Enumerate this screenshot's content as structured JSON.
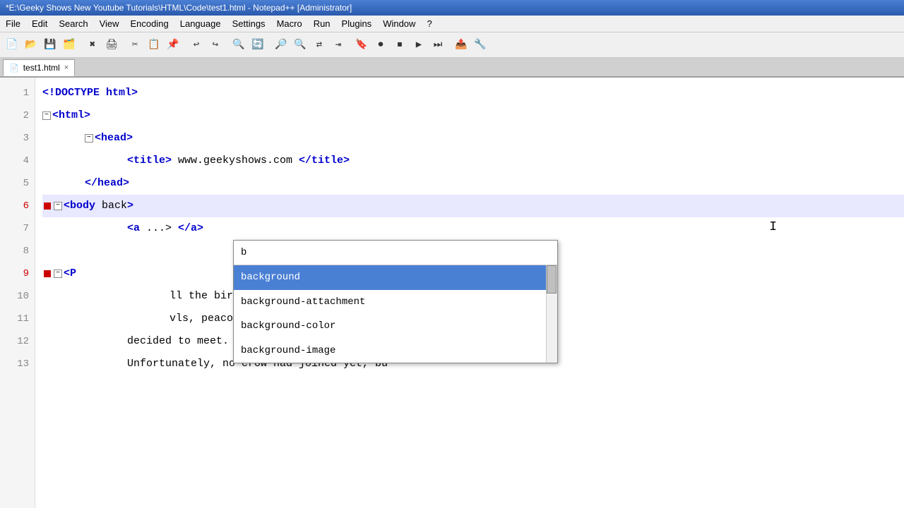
{
  "title_bar": {
    "text": "*E:\\Geeky Shows New Youtube Tutorials\\HTML\\Code\\test1.html - Notepad++ [Administrator]"
  },
  "menu": {
    "items": [
      "File",
      "Edit",
      "Search",
      "View",
      "Encoding",
      "Language",
      "Settings",
      "Macro",
      "Run",
      "Plugins",
      "Window",
      "?"
    ]
  },
  "tab": {
    "filename": "test1.html",
    "close_label": "×"
  },
  "code": {
    "lines": [
      {
        "num": 1,
        "content": "<!DOCTYPE html>",
        "type": "doctype",
        "indent": 0
      },
      {
        "num": 2,
        "content": "<html>",
        "type": "tag",
        "indent": 0,
        "collapse": true
      },
      {
        "num": 3,
        "content": "<head>",
        "type": "tag",
        "indent": 1,
        "collapse": true
      },
      {
        "num": 4,
        "content": "<title> www.geekyshows.com </title>",
        "type": "mixed",
        "indent": 2
      },
      {
        "num": 5,
        "content": "</head>",
        "type": "tag",
        "indent": 1
      },
      {
        "num": 6,
        "content": "<body back>",
        "type": "tag-partial",
        "indent": 1,
        "highlighted": true,
        "collapse": true
      },
      {
        "num": 7,
        "content": "<a ...> </a>",
        "type": "tag",
        "indent": 2
      },
      {
        "num": 8,
        "content": "",
        "type": "empty",
        "indent": 0
      },
      {
        "num": 9,
        "content": "<P",
        "type": "tag-partial",
        "indent": 1,
        "collapse": true
      },
      {
        "num": 10,
        "content": "ll the birds - the swa",
        "type": "text",
        "indent": 3
      },
      {
        "num": 11,
        "content": "vls, peacocks, doves a",
        "type": "text",
        "indent": 3
      },
      {
        "num": 12,
        "content": "decided to meet. They had to discuss a su",
        "type": "text",
        "indent": 2
      },
      {
        "num": 13,
        "content": "Unfortunately, no crow had joined yet, bu",
        "type": "text",
        "indent": 2
      }
    ]
  },
  "autocomplete": {
    "input": "b",
    "items": [
      {
        "label": "background",
        "selected": true
      },
      {
        "label": "background-attachment",
        "selected": false
      },
      {
        "label": "background-color",
        "selected": false
      },
      {
        "label": "background-image",
        "selected": false
      }
    ]
  },
  "colors": {
    "tag_color": "#0000cc",
    "selected_bg": "#4a80d4",
    "highlight_line": "#e8e8ff",
    "doctype_color": "#0000cc"
  }
}
